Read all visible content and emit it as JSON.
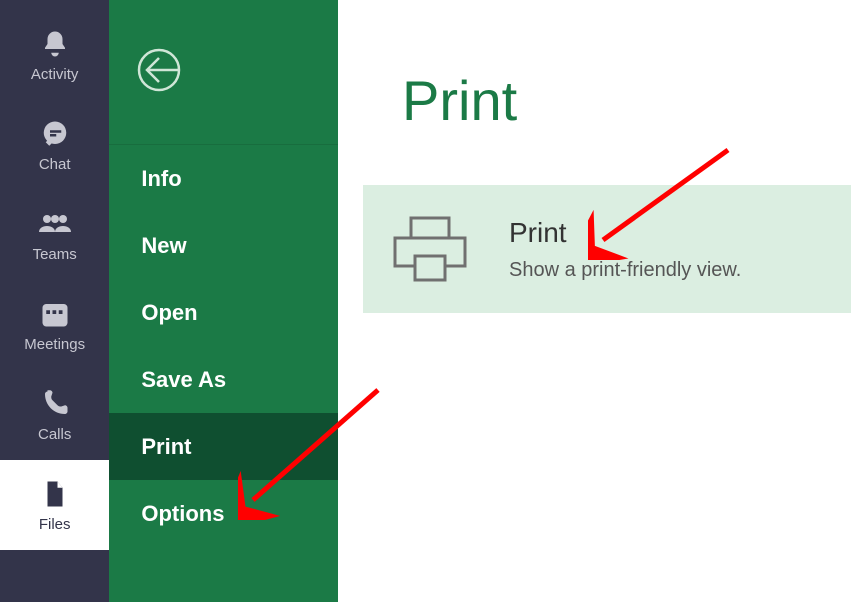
{
  "rail": {
    "items": [
      {
        "id": "activity",
        "label": "Activity"
      },
      {
        "id": "chat",
        "label": "Chat"
      },
      {
        "id": "teams",
        "label": "Teams"
      },
      {
        "id": "meetings",
        "label": "Meetings"
      },
      {
        "id": "calls",
        "label": "Calls"
      },
      {
        "id": "files",
        "label": "Files"
      }
    ],
    "selected": "files"
  },
  "file_menu": {
    "items": [
      {
        "id": "info",
        "label": "Info"
      },
      {
        "id": "new",
        "label": "New"
      },
      {
        "id": "open",
        "label": "Open"
      },
      {
        "id": "saveas",
        "label": "Save As"
      },
      {
        "id": "print",
        "label": "Print"
      },
      {
        "id": "options",
        "label": "Options"
      }
    ],
    "selected": "print"
  },
  "main": {
    "title": "Print",
    "card": {
      "title": "Print",
      "subtitle": "Show a print-friendly view."
    }
  }
}
